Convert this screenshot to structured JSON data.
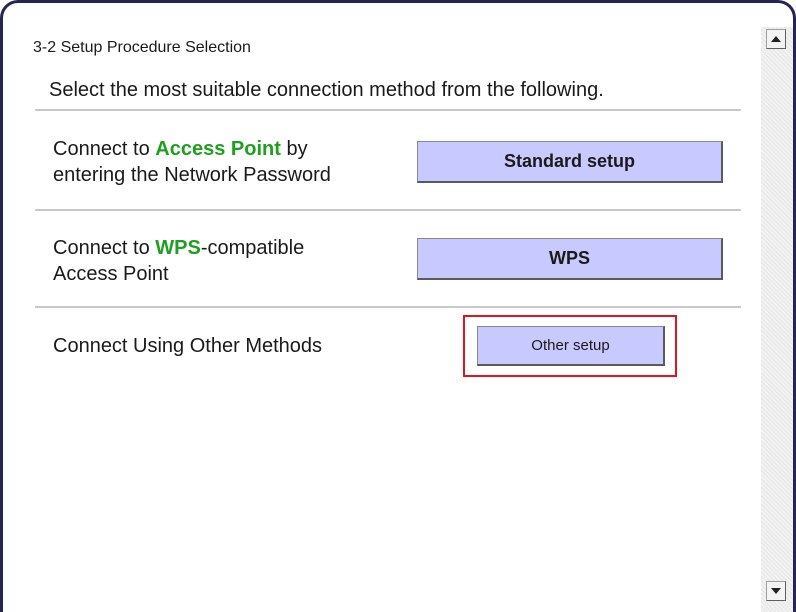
{
  "page": {
    "section_title": "3-2 Setup Procedure Selection",
    "instruction": "Select the most suitable connection method from the following."
  },
  "options": [
    {
      "line1_prefix": "Connect to ",
      "line1_highlight": "Access Point",
      "line1_suffix": " by",
      "line2": "entering the Network Password",
      "button_label": "Standard setup"
    },
    {
      "line1_prefix": "Connect to ",
      "line1_highlight": "WPS",
      "line1_suffix": "-compatible",
      "line2": "Access Point",
      "button_label": "WPS"
    },
    {
      "text": "Connect Using Other Methods",
      "button_label": "Other setup",
      "highlighted": true
    }
  ],
  "scrollbar": {
    "up_icon": "arrow-up-icon",
    "down_icon": "arrow-down-icon"
  },
  "colors": {
    "button_fill": "#c8c9ff",
    "highlight_text": "#1f9f1f",
    "callout_border": "#e0141c",
    "frame_border": "#252452"
  }
}
